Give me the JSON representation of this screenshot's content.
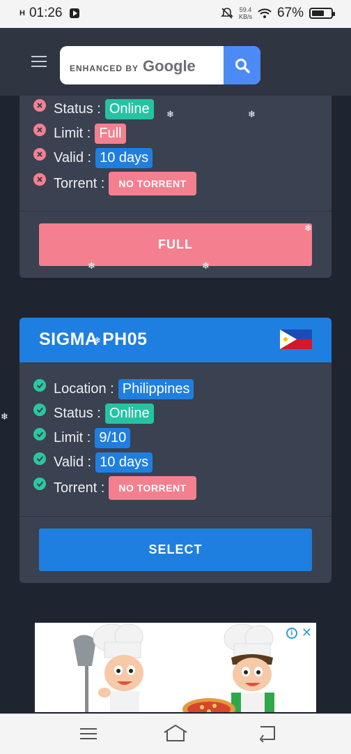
{
  "status_bar": {
    "time": "01:26",
    "signal": "H",
    "net_speed_value": "59.4",
    "net_speed_unit": "KB/s",
    "battery": "67%",
    "battery_level": 0.67
  },
  "header": {
    "search_prefix": "ENHANCED BY",
    "search_brand": "Google"
  },
  "server_full": {
    "rows": [
      {
        "label": "Status :",
        "value": "Online",
        "state": "error"
      },
      {
        "label": "Limit :",
        "value": "Full",
        "state": "error"
      },
      {
        "label": "Valid :",
        "value": "10 days",
        "state": "error"
      },
      {
        "label": "Torrent :",
        "value": "NO TORRENT",
        "state": "error"
      }
    ],
    "button_label": "FULL"
  },
  "server_ph05": {
    "title": "SIGMA PH05",
    "flag": "philippines-flag",
    "rows": [
      {
        "label": "Location :",
        "value": "Philippines",
        "state": "ok"
      },
      {
        "label": "Status :",
        "value": "Online",
        "state": "ok"
      },
      {
        "label": "Limit :",
        "value": "9/10",
        "state": "ok"
      },
      {
        "label": "Valid :",
        "value": "10 days",
        "state": "ok"
      },
      {
        "label": "Torrent :",
        "value": "NO TORRENT",
        "state": "ok"
      }
    ],
    "button_label": "SELECT"
  },
  "ad": {
    "info_glyph": "i",
    "close_glyph": "✕"
  },
  "colors": {
    "accent_blue": "#1f7fe0",
    "online_green": "#24c4a2",
    "full_pink": "#f4808f",
    "card_bg": "#3a4150",
    "page_bg": "#1f2530"
  }
}
